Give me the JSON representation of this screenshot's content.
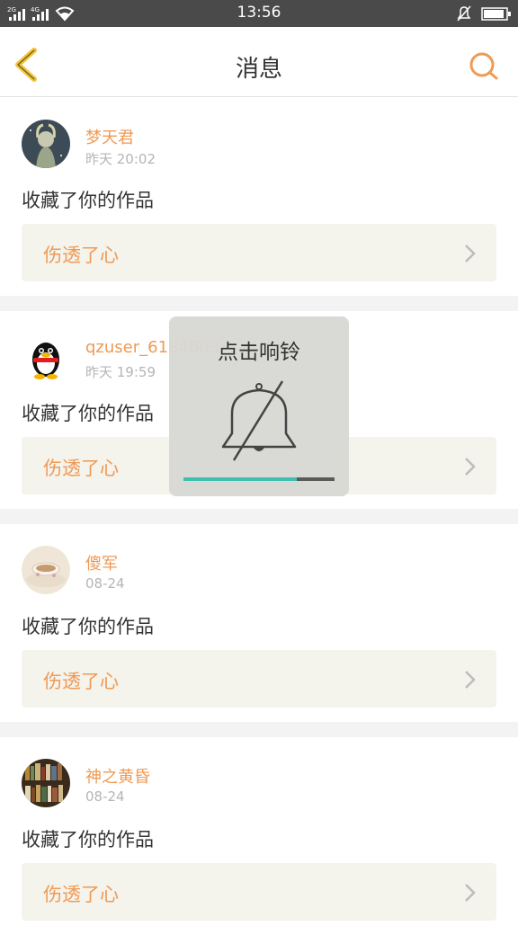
{
  "status_bar": {
    "sim1": "2G",
    "sim2": "4G",
    "time": "13:56"
  },
  "header": {
    "title": "消息"
  },
  "colors": {
    "accent": "#ef9a55",
    "status_bar_bg": "#4a4a4a",
    "progress_fill": "#3fbfae"
  },
  "feed": [
    {
      "username": "梦天君",
      "time": "昨天 20:02",
      "action": "收藏了你的作品",
      "work_title": "伤透了心",
      "avatar_icon": "anime-girl-avatar"
    },
    {
      "username": "qzuser_6184609",
      "time": "昨天 19:59",
      "action": "收藏了你的作品",
      "work_title": "伤透了心",
      "avatar_icon": "qq-penguin-avatar"
    },
    {
      "username": "傻军",
      "time": "08-24",
      "action": "收藏了你的作品",
      "work_title": "伤透了心",
      "avatar_icon": "teacup-avatar"
    },
    {
      "username": "神之黄昏",
      "time": "08-24",
      "action": "收藏了你的作品",
      "work_title": "伤透了心",
      "avatar_icon": "bookshelf-avatar"
    }
  ],
  "toast": {
    "text": "点击响铃",
    "icon": "bell-muted-icon",
    "progress": 0.75
  }
}
